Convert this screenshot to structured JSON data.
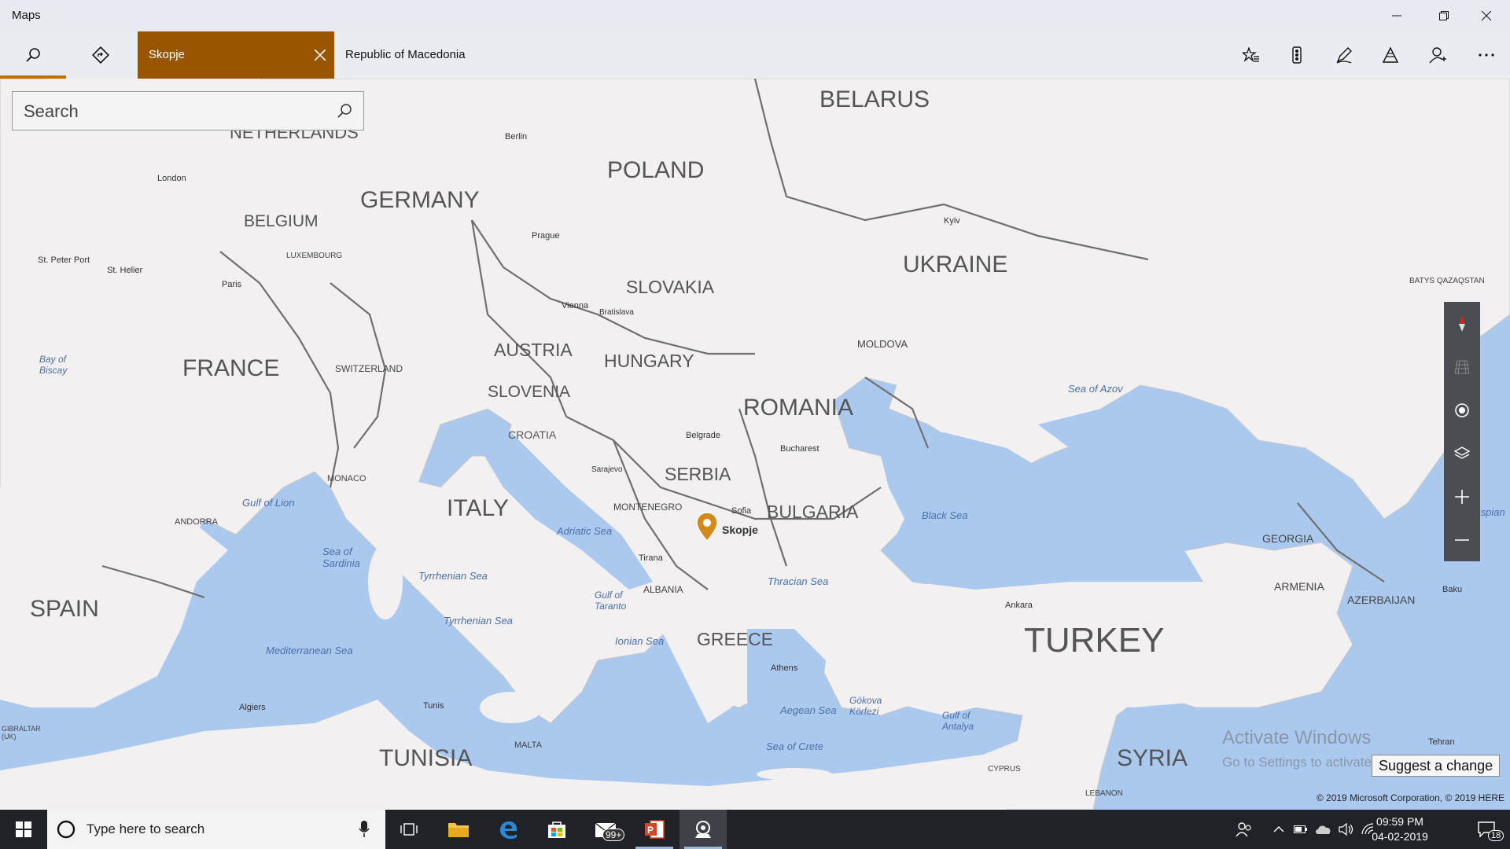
{
  "app": {
    "title": "Maps"
  },
  "window": {
    "minimize_icon": "minimize-icon",
    "maximize_icon": "restore-icon",
    "close_icon": "close-icon"
  },
  "toolbar": {
    "search_icon": "search-icon",
    "directions_icon": "directions-icon",
    "active_tab_label": "Skopje",
    "location_title": "Republic of Macedonia",
    "right_icons": [
      "favorites-icon",
      "traffic-icon",
      "ink-icon",
      "3d-cities-icon",
      "account-icon",
      "more-icon"
    ],
    "accent_color": "#9a5500"
  },
  "search": {
    "placeholder": "Search"
  },
  "map": {
    "pin_label": "Skopje",
    "countries": [
      "BELARUS",
      "POLAND",
      "GERMANY",
      "BELGIUM",
      "UKRAINE",
      "SLOVAKIA",
      "FRANCE",
      "AUSTRIA",
      "HUNGARY",
      "SLOVENIA",
      "ROMANIA",
      "CROATIA",
      "SERBIA",
      "BULGARIA",
      "ITALY",
      "SPAIN",
      "GREECE",
      "TURKEY",
      "TUNISIA",
      "SYRIA",
      "GEORGIA",
      "ARMENIA",
      "AZERBAIJAN",
      "MOLDOVA",
      "SWITZERLAND",
      "ALBANIA",
      "MONTENEGRO",
      "LUXEMBOURG",
      "MONACO",
      "ANDORRA",
      "MALTA",
      "CYPRUS",
      "LEBANON",
      "NETHERLANDS"
    ],
    "cities": [
      "Berlin",
      "London",
      "Prague",
      "Kyiv",
      "St. Peter Port",
      "St. Helier",
      "Paris",
      "Vienna",
      "Bratislava",
      "Belgrade",
      "Bucharest",
      "Sarajevo",
      "Sofia",
      "Tirana",
      "Ankara",
      "Athens",
      "Algiers",
      "Tunis",
      "Baku",
      "Tehran"
    ],
    "water": [
      "Bay of Biscay",
      "Sea of Azov",
      "Black Sea",
      "Gulf of Lion",
      "Adriatic Sea",
      "Sea of Sardinia",
      "Tyrrhenian Sea",
      "Tyrrhenian Sea",
      "Gulf of Taranto",
      "Ionian Sea",
      "Thracian Sea",
      "Mediterranean Sea",
      "Aegean Sea",
      "Gökova Körfezi",
      "Gulf of Antalya",
      "Sea of Crete",
      "Caspian"
    ],
    "other": [
      "GIBRALTAR (UK)",
      "BATYS QAZAQSTAN"
    ]
  },
  "map_controls": [
    "compass-icon",
    "tilt-icon",
    "my-location-icon",
    "layers-icon",
    "zoom-in-icon",
    "zoom-out-icon"
  ],
  "watermark": {
    "title": "Activate Windows",
    "subtitle": "Go to Settings to activate Windows."
  },
  "suggest_change": "Suggest a change",
  "copyright": "© 2019 Microsoft Corporation, © 2019 HERE",
  "taskbar": {
    "search_placeholder": "Type here to search",
    "mail_badge": "99+",
    "time": "09:59 PM",
    "date": "04-02-2019",
    "notification_count": "18"
  }
}
